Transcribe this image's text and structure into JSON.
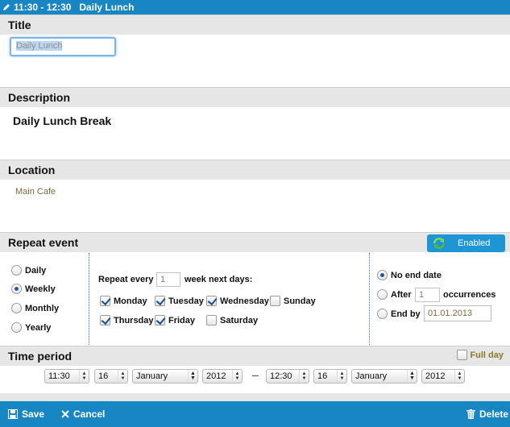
{
  "header": {
    "time_range": "11:30 - 12:30",
    "event_title": "Daily Lunch"
  },
  "sections": {
    "title": {
      "label": "Title",
      "value": "Daily Lunch"
    },
    "description": {
      "label": "Description",
      "value": "Daily Lunch Break"
    },
    "location": {
      "label": "Location",
      "value": "Main Cafe"
    },
    "repeat": {
      "label": "Repeat event",
      "toggle_label": "Enabled"
    },
    "time_period": {
      "label": "Time period"
    }
  },
  "repeat": {
    "frequency_options": [
      {
        "label": "Daily",
        "selected": false
      },
      {
        "label": "Weekly",
        "selected": true
      },
      {
        "label": "Monthly",
        "selected": false
      },
      {
        "label": "Yearly",
        "selected": false
      }
    ],
    "repeat_every_label": "Repeat every",
    "repeat_every_value": "1",
    "week_next_days_label": "week next days:",
    "days": [
      {
        "label": "Monday",
        "checked": true
      },
      {
        "label": "Tuesday",
        "checked": true
      },
      {
        "label": "Wednesday",
        "checked": true
      },
      {
        "label": "Sunday",
        "checked": false
      },
      {
        "label": "Thursday",
        "checked": true
      },
      {
        "label": "Friday",
        "checked": true
      },
      {
        "label": "Saturday",
        "checked": false
      }
    ],
    "end": {
      "no_end_label": "No end date",
      "after_label": "After",
      "after_value": "1",
      "occurrences_label": "occurrences",
      "end_by_label": "End by",
      "end_by_value": "01.01.2013",
      "selected": "no_end"
    }
  },
  "time_period": {
    "full_day_label": "Full day",
    "full_day_checked": false,
    "start": {
      "time": "11:30",
      "day": "16",
      "month": "January",
      "year": "2012"
    },
    "separator": "–",
    "end": {
      "time": "12:30",
      "day": "16",
      "month": "January",
      "year": "2012"
    }
  },
  "footer": {
    "save_label": "Save",
    "cancel_label": "Cancel",
    "delete_label": "Delete"
  },
  "colors": {
    "accent": "#1786c2",
    "section_bg": "#e6e6e6",
    "location_text": "#7d6a3a"
  }
}
